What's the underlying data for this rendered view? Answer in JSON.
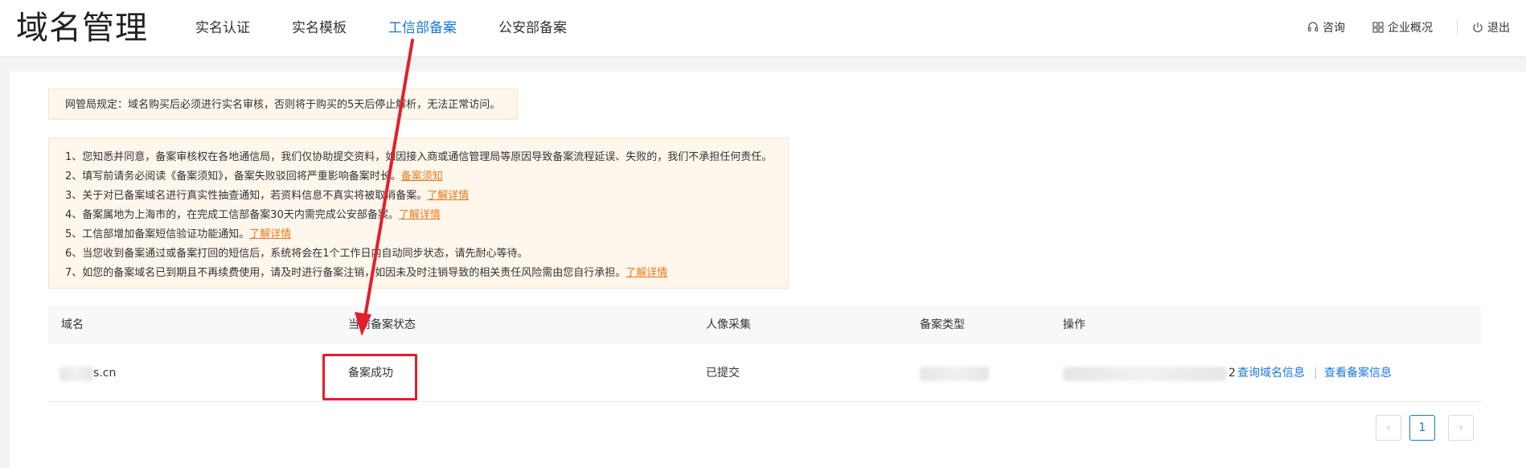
{
  "header": {
    "brand": "域名管理",
    "nav": [
      {
        "label": "实名认证"
      },
      {
        "label": "实名模板"
      },
      {
        "label": "工信部备案"
      },
      {
        "label": "公安部备案"
      }
    ],
    "right": {
      "consult": "咨询",
      "overview": "企业概况",
      "logout": "退出"
    }
  },
  "notice_top": "网管局规定：域名购买后必须进行实名审核，否则将于购买的5天后停止解析，无法正常访问。",
  "notices": [
    {
      "text": "1、您知悉并同意，备案审核权在各地通信局，我们仅协助提交资料，如因接入商或通信管理局等原因导致备案流程延误、失败的，我们不承担任何责任。",
      "link": ""
    },
    {
      "text": "2、填写前请务必阅读《备案须知》，备案失败驳回将严重影响备案时长。",
      "link": "备案须知"
    },
    {
      "text": "3、关于对已备案域名进行真实性抽查通知，若资料信息不真实将被取消备案。",
      "link": "了解详情"
    },
    {
      "text": "4、备案属地为上海市的，在完成工信部备案30天内需完成公安部备案。",
      "link": "了解详情"
    },
    {
      "text": "5、工信部增加备案短信验证功能通知。",
      "link": "了解详情"
    },
    {
      "text": "6、当您收到备案通过或备案打回的短信后，系统将会在1个工作日内自动同步状态，请先耐心等待。",
      "link": ""
    },
    {
      "text": "7、如您的备案域名已到期且不再续费使用，请及时进行备案注销，如因未及时注销导致的相关责任风险需由您自行承担。",
      "link": "了解详情"
    }
  ],
  "table": {
    "headers": {
      "domain": "域名",
      "status": "当前备案状态",
      "face": "人像采集",
      "type": "备案类型",
      "action": "操作"
    },
    "rows": [
      {
        "domain": "s.cn",
        "status": "备案成功",
        "face": "已提交",
        "action_prefix": "2",
        "action_query": "查询域名信息",
        "action_sep": "|",
        "action_view": "查看备案信息"
      }
    ]
  },
  "pagination": {
    "prev": "‹",
    "current": "1",
    "next": "›"
  },
  "colors": {
    "accent": "#1677e6",
    "link_orange": "#f07a1a",
    "notice_bg": "#fff6ec",
    "annotation_red": "#e41e2b"
  }
}
